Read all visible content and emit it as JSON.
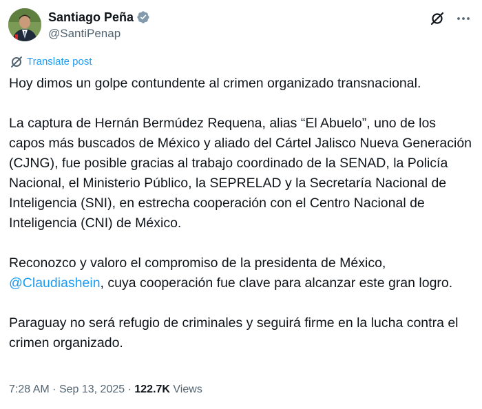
{
  "author": {
    "display_name": "Santiago Peña",
    "handle": "@SantiPenap",
    "verified_color": "#829aab"
  },
  "actions": {
    "grok_icon": "slashed-circle-icon",
    "more_icon": "more-horizontal-icon"
  },
  "translate": {
    "label": "Translate post"
  },
  "tweet": {
    "p1": "Hoy dimos un golpe contundente al crimen organizado transnacional.",
    "p2": "La captura de Hernán Bermúdez Requena, alias “El Abuelo”, uno de los capos más buscados de México y aliado del Cártel Jalisco Nueva Generación (CJNG), fue posible gracias al trabajo coordinado de la SENAD, la Policía Nacional, el Ministerio Público, la SEPRELAD y la Secretaría Nacional de Inteligencia (SNI), en estrecha cooperación con el Centro Nacional de Inteligencia (CNI) de México.",
    "p3_before": "Reconozco y valoro el compromiso de la presidenta de México,",
    "p3_mention": "@Claudiashein",
    "p3_after": ", cuya cooperación fue clave para alcanzar este gran logro.",
    "p4": "Paraguay no será refugio de criminales y seguirá firme en la lucha contra el crimen organizado."
  },
  "meta": {
    "time": "7:28 AM",
    "separator": "·",
    "date": "Sep 13, 2025",
    "views_count": "122.7K",
    "views_label": "Views"
  },
  "colors": {
    "link": "#1d9bf0",
    "secondary_text": "#536471",
    "primary_text": "#0f1419"
  }
}
